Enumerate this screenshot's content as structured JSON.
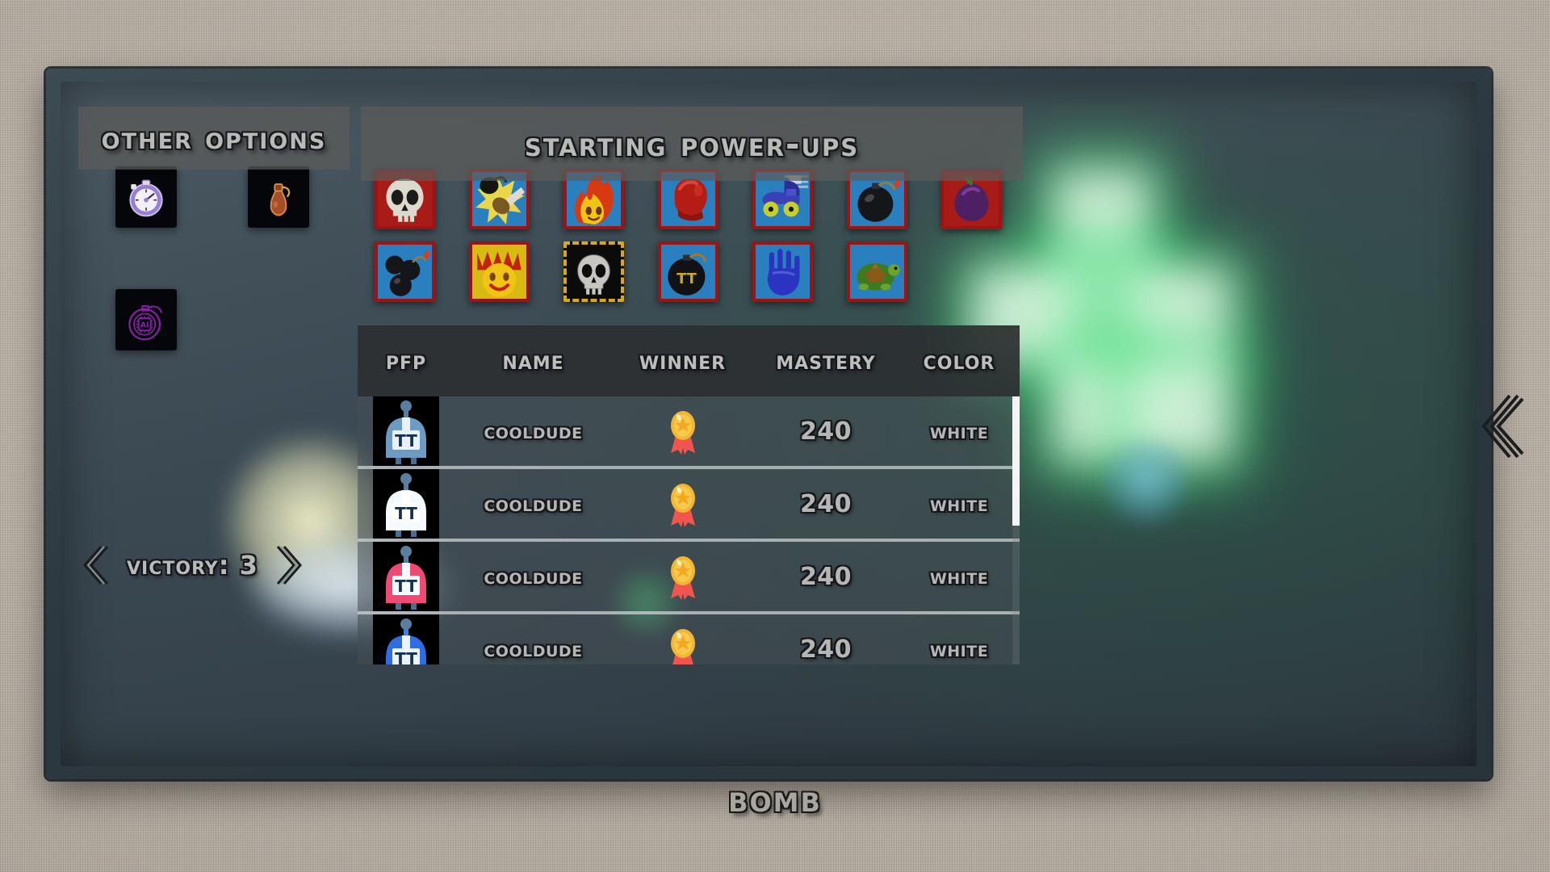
{
  "panels": {
    "other_options_title": "Other Options",
    "starting_powerups_title": "Starting Power-ups"
  },
  "other_options": [
    {
      "name": "stopwatch-timer",
      "label": "Timer",
      "color": "#9a7fd1"
    },
    {
      "name": "potion-flask",
      "label": "Potion",
      "color": "#a3502a"
    },
    {
      "name": "ai-bomb",
      "label": "AI Bomb",
      "color": "#8a1fa8"
    }
  ],
  "powerups": [
    {
      "name": "skull",
      "label": "Skull",
      "bg": "red"
    },
    {
      "name": "punch-blast",
      "label": "Punch",
      "bg": "blue"
    },
    {
      "name": "fire-face",
      "label": "Fire",
      "bg": "blue"
    },
    {
      "name": "boxing-glove",
      "label": "Boxing Glove",
      "bg": "blue"
    },
    {
      "name": "roller-skate",
      "label": "Skate",
      "bg": "blue"
    },
    {
      "name": "black-bomb",
      "label": "Bomb",
      "bg": "blue"
    },
    {
      "name": "purple-fig",
      "label": "Fig",
      "bg": "red"
    },
    {
      "name": "bomb-cluster",
      "label": "Cluster Bomb",
      "bg": "blue"
    },
    {
      "name": "flame-grin",
      "label": "Flame",
      "bg": "yellow"
    },
    {
      "name": "ghost-skull",
      "label": "Ghost",
      "bg": "black"
    },
    {
      "name": "tt-bomb",
      "label": "TT Bomb",
      "bg": "blue"
    },
    {
      "name": "blue-glove",
      "label": "Glove",
      "bg": "blue"
    },
    {
      "name": "turtle",
      "label": "Turtle",
      "bg": "blue"
    }
  ],
  "leaderboard": {
    "columns": [
      "PFP",
      "Name",
      "Winner",
      "Mastery",
      "Color"
    ],
    "rows": [
      {
        "name": "CoolDude",
        "winner": "medal",
        "mastery": "240",
        "color": "White",
        "avatar": "steel-blue"
      },
      {
        "name": "CoolDude",
        "winner": "medal",
        "mastery": "240",
        "color": "White",
        "avatar": "white"
      },
      {
        "name": "CoolDude",
        "winner": "medal",
        "mastery": "240",
        "color": "White",
        "avatar": "pink"
      },
      {
        "name": "CoolDude",
        "winner": "medal",
        "mastery": "240",
        "color": "White",
        "avatar": "blue"
      }
    ]
  },
  "victory": {
    "label": "Victory: 3",
    "prev": "«",
    "next": "»"
  },
  "bottom_caption": "Bomb",
  "colors": {
    "powerup_border": "#9e1414",
    "powerup_blue_bg": "#2a7fbe",
    "powerup_red_bg": "#a81c18",
    "text": "#b9b9b7",
    "panel_bg": "#5c5c5a",
    "glow_green": "#3ce678"
  }
}
